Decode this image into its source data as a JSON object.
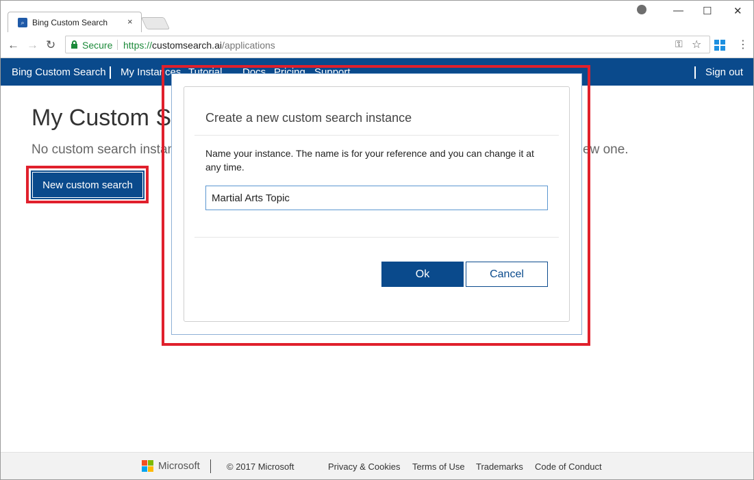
{
  "browser": {
    "tab_title": "Bing Custom Search",
    "tab_close": "×",
    "window_controls": {
      "minimize": "—",
      "maximize": "☐",
      "close": "✕"
    },
    "secure_label": "Secure",
    "url_scheme": "https://",
    "url_host": "customsearch.ai",
    "url_path": "/applications"
  },
  "sitenav": {
    "brand": "Bing Custom Search",
    "items": [
      "My Instances",
      "Tutorial",
      "Docs",
      "Pricing",
      "Support"
    ],
    "signout": "Sign out"
  },
  "page": {
    "title": "My Custom Se",
    "subtitle": "No custom search instan",
    "subtitle_tail": "ew one.",
    "new_button_label": "New custom search"
  },
  "modal": {
    "title": "Create a new custom search instance",
    "description": "Name your instance. The name is for your reference and you can change it at any time.",
    "input_value": "Martial Arts Topic",
    "ok_label": "Ok",
    "cancel_label": "Cancel"
  },
  "footer": {
    "brand": "Microsoft",
    "copyright": "© 2017 Microsoft",
    "links": [
      "Privacy & Cookies",
      "Terms of Use",
      "Trademarks",
      "Code of Conduct"
    ]
  },
  "colors": {
    "nav_blue": "#0a4a8c",
    "highlight_red": "#e0202c",
    "secure_green": "#1c8a3a"
  }
}
